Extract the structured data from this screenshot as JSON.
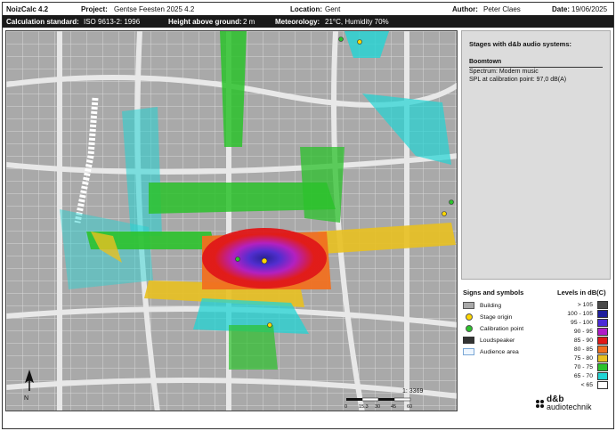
{
  "header": {
    "app": "NoizCalc 4.2",
    "project_label": "Project:",
    "project_value": "Gentse Feesten 2025 4.2",
    "location_label": "Location:",
    "location_value": "Gent",
    "author_label": "Author:",
    "author_value": "Peter Claes",
    "date_label": "Date:",
    "date_value": "19/06/2025"
  },
  "subheader": {
    "standard_label": "Calculation standard:",
    "standard_value": "ISO 9613-2: 1996",
    "height_label": "Height above ground:",
    "height_value": "2 m",
    "meteo_label": "Meteorology:",
    "meteo_value": "21°C, Humidity 70%"
  },
  "stages": {
    "title": "Stages with d&b audio systems:",
    "name": "Boomtown",
    "spectrum": "Spectrum:  Modern music",
    "spl": "SPL at calibration point:  97,0 dB(A)"
  },
  "signs": {
    "title": "Signs and symbols",
    "items": [
      "Building",
      "Stage origin",
      "Calibration point",
      "Loudspeaker",
      "Audience area"
    ]
  },
  "levels": {
    "title": "Levels in dB(C)",
    "items": [
      {
        "label": "> 105",
        "color": "#4a4a4a"
      },
      {
        "label": "100 - 105",
        "color": "#1e1e9c"
      },
      {
        "label": "95 - 100",
        "color": "#4a2ad8"
      },
      {
        "label": "90 - 95",
        "color": "#b01cc8"
      },
      {
        "label": "85 - 90",
        "color": "#e01818"
      },
      {
        "label": "80 - 85",
        "color": "#f07020"
      },
      {
        "label": "75 - 80",
        "color": "#e8c020"
      },
      {
        "label": "70 - 75",
        "color": "#2cc22c"
      },
      {
        "label": "65 - 70",
        "color": "#22d4d4"
      },
      {
        "label": "< 65",
        "color": "#ffffff"
      }
    ]
  },
  "map": {
    "scale": "1: 3369",
    "scale_ticks": [
      "0",
      "15.3",
      "30",
      "45",
      "60"
    ],
    "north": "N"
  },
  "brand": {
    "logo": "d&b",
    "name": "audiotechnik"
  }
}
